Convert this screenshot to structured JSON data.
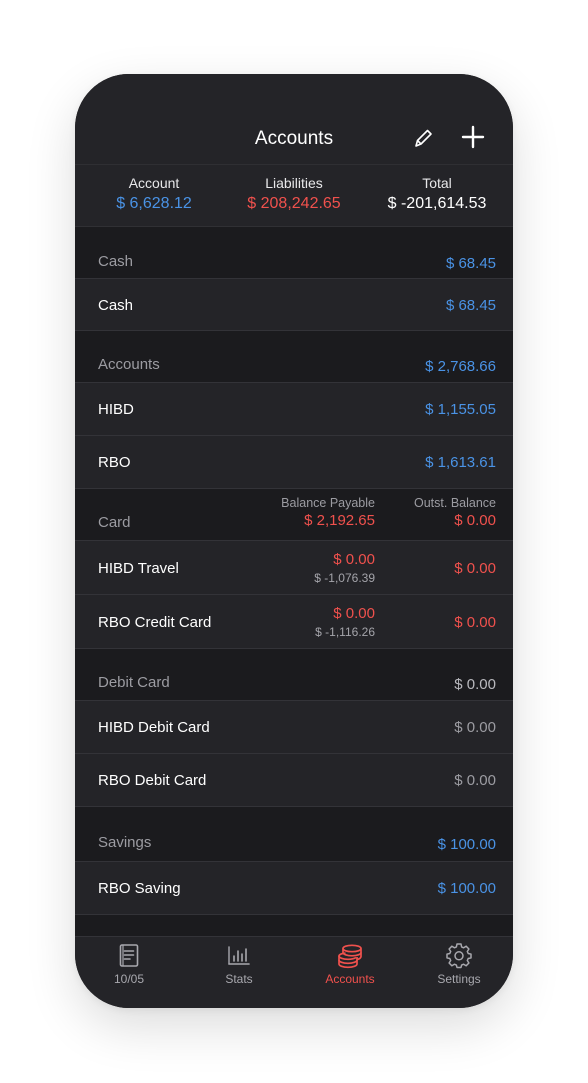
{
  "header": {
    "title": "Accounts",
    "edit_icon": "pencil-icon",
    "add_icon": "plus-icon"
  },
  "summary": {
    "account_label": "Account",
    "account_value": "$ 6,628.12",
    "liabilities_label": "Liabilities",
    "liabilities_value": "$ 208,242.65",
    "total_label": "Total",
    "total_value": "$ -201,614.53"
  },
  "groups": {
    "cash": {
      "label": "Cash",
      "total": "$ 68.45",
      "items": [
        {
          "name": "Cash",
          "amount": "$ 68.45"
        }
      ]
    },
    "accounts": {
      "label": "Accounts",
      "total": "$ 2,768.66",
      "items": [
        {
          "name": "HIBD",
          "amount": "$ 1,155.05"
        },
        {
          "name": "RBO",
          "amount": "$ 1,613.61"
        }
      ]
    },
    "card": {
      "label": "Card",
      "balance_payable_label": "Balance Payable",
      "balance_payable_value": "$ 2,192.65",
      "outst_balance_label": "Outst. Balance",
      "outst_balance_value": "$ 0.00",
      "items": [
        {
          "name": "HIBD Travel",
          "payable": "$ 0.00",
          "sub": "$ -1,076.39",
          "outstanding": "$ 0.00"
        },
        {
          "name": "RBO Credit Card",
          "payable": "$ 0.00",
          "sub": "$ -1,116.26",
          "outstanding": "$ 0.00"
        }
      ]
    },
    "debit": {
      "label": "Debit Card",
      "total": "$ 0.00",
      "items": [
        {
          "name": "HIBD Debit Card",
          "amount": "$ 0.00"
        },
        {
          "name": "RBO Debit Card",
          "amount": "$ 0.00"
        }
      ]
    },
    "savings": {
      "label": "Savings",
      "total": "$ 100.00",
      "items": [
        {
          "name": "RBO Saving",
          "amount": "$ 100.00"
        }
      ]
    }
  },
  "tabbar": {
    "tabs": [
      {
        "label": "10/05",
        "icon": "notebook-icon"
      },
      {
        "label": "Stats",
        "icon": "bar-chart-icon"
      },
      {
        "label": "Accounts",
        "icon": "coins-icon"
      },
      {
        "label": "Settings",
        "icon": "gear-icon"
      }
    ],
    "active": "Accounts"
  },
  "colors": {
    "background": "#1b1b1e",
    "row": "#242428",
    "positive": "#4a93e6",
    "negative": "#f0514d",
    "neutral": "#b9b9be"
  }
}
